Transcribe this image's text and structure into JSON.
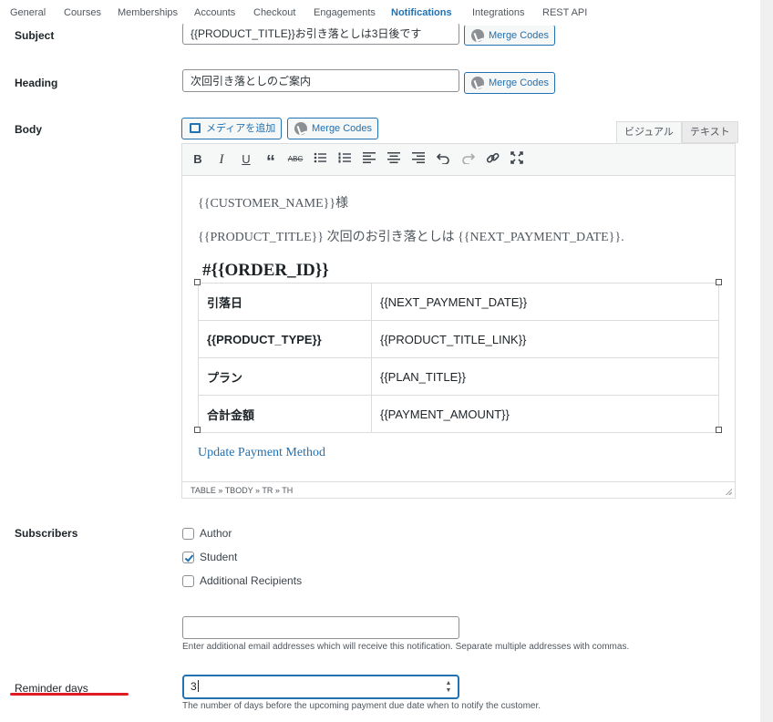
{
  "tabs": [
    {
      "label": "General"
    },
    {
      "label": "Courses"
    },
    {
      "label": "Memberships"
    },
    {
      "label": "Accounts"
    },
    {
      "label": "Checkout"
    },
    {
      "label": "Engagements"
    },
    {
      "label": "Notifications",
      "active": true
    },
    {
      "label": "Integrations"
    },
    {
      "label": "REST API"
    }
  ],
  "merge_codes_label": "Merge Codes",
  "subject": {
    "label": "Subject",
    "value": "{{PRODUCT_TITLE}}お引き落としは3日後です"
  },
  "heading": {
    "label": "Heading",
    "value": "次回引き落としのご案内"
  },
  "body": {
    "label": "Body",
    "add_media_label": "メディアを追加",
    "visual_tab": "ビジュアル",
    "text_tab": "テキスト",
    "toolbar_icons": [
      "bold-icon",
      "italic-icon",
      "underline-icon",
      "blockquote-icon",
      "strikethrough-icon",
      "bullet-list-icon",
      "numbered-list-icon",
      "align-left-icon",
      "align-center-icon",
      "align-right-icon",
      "undo-icon",
      "redo-icon",
      "link-icon",
      "fullscreen-icon"
    ],
    "greeting": "{{CUSTOMER_NAME}}様",
    "line2": "{{PRODUCT_TITLE}} 次回のお引き落としは {{NEXT_PAYMENT_DATE}}.",
    "order_heading": "#{{ORDER_ID}}",
    "table": [
      {
        "key": "引落日",
        "value": "{{NEXT_PAYMENT_DATE}}"
      },
      {
        "key": "{{PRODUCT_TYPE}}",
        "value": "{{PRODUCT_TITLE_LINK}}"
      },
      {
        "key": "プラン",
        "value": "{{PLAN_TITLE}}"
      },
      {
        "key": "合計金額",
        "value": "{{PAYMENT_AMOUNT}}"
      }
    ],
    "update_link": "Update Payment Method",
    "path": "TABLE » TBODY » TR » TH"
  },
  "subscribers": {
    "label": "Subscribers",
    "options": [
      {
        "label": "Author",
        "checked": false
      },
      {
        "label": "Student",
        "checked": true
      },
      {
        "label": "Additional Recipients",
        "checked": false
      }
    ],
    "recipients_value": "",
    "recipients_help": "Enter additional email addresses which will receive this notification. Separate multiple addresses with commas."
  },
  "reminder": {
    "label": "Reminder days",
    "value": "3",
    "help": "The number of days before the upcoming payment due date when to notify the customer."
  },
  "colors": {
    "accent": "#2271b1",
    "annotation": "#e01b24"
  }
}
